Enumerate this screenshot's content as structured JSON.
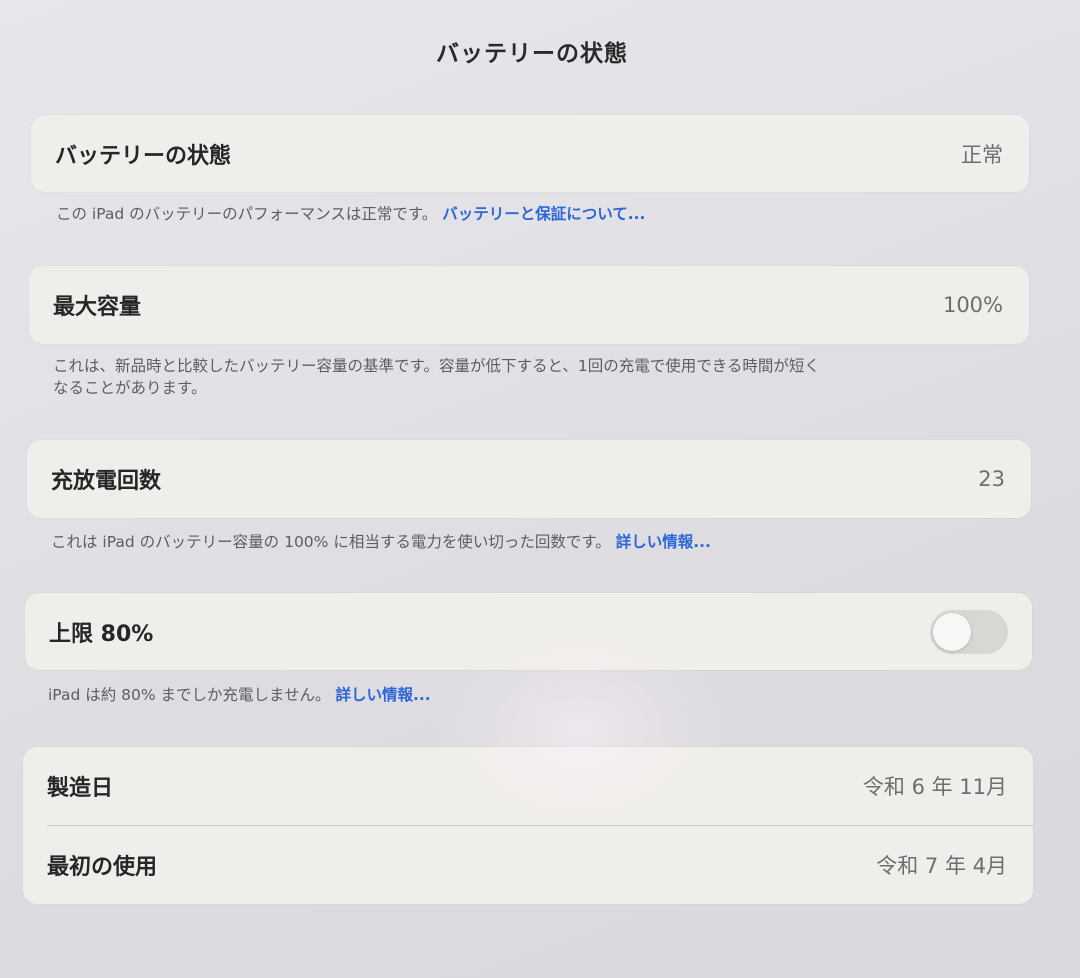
{
  "header": {
    "title": "バッテリーの状態"
  },
  "battery_health": {
    "label": "バッテリーの状態",
    "value": "正常",
    "note": "この iPad のバッテリーのパフォーマンスは正常です。",
    "link": "バッテリーと保証について..."
  },
  "max_capacity": {
    "label": "最大容量",
    "value": "100%",
    "note_line1": "これは、新品時と比較したバッテリー容量の基準です。容量が低下すると、1回の充電で使用できる時間が短く",
    "note_line2": "なることがあります。"
  },
  "cycle_count": {
    "label": "充放電回数",
    "value": "23",
    "note": "これは iPad のバッテリー容量の 100% に相当する電力を使い切った回数です。",
    "link": "詳しい情報..."
  },
  "limit_80": {
    "label": "上限 80%",
    "toggle_on": false,
    "note": "iPad は約 80% までしか充電しません。",
    "link": "詳しい情報..."
  },
  "dates": {
    "manufacture_label": "製造日",
    "manufacture_value": "令和 6 年 11月",
    "first_use_label": "最初の使用",
    "first_use_value": "令和 7 年 4月"
  }
}
